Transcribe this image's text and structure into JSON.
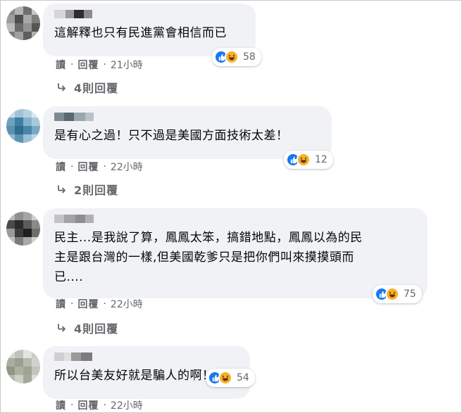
{
  "comments": [
    {
      "text": "這解釋也只有民進黨會相信而已",
      "reaction_count": "58",
      "actions": {
        "read": "讀",
        "reply": "回覆",
        "time": "21小時"
      },
      "replies_label": "4則回覆"
    },
    {
      "text": "是有心之過！只不過是美國方面技術太差！",
      "reaction_count": "12",
      "actions": {
        "read": "讀",
        "reply": "回覆",
        "time": "22小時"
      },
      "replies_label": "2則回覆"
    },
    {
      "text_lines": [
        "民主...是我說了算，鳳鳳太笨，搞錯地點，鳳鳳以為的民",
        "主是跟台灣的一樣,但美國乾爹只是把你們叫來摸摸頭而",
        "已...."
      ],
      "reaction_count": "75",
      "actions": {
        "read": "讀",
        "reply": "回覆",
        "time": "22小時"
      },
      "replies_label": "4則回覆"
    },
    {
      "text": "所以台美友好就是騙人的啊！",
      "reaction_count": "54",
      "actions": {
        "read": "讀",
        "reply": "回覆",
        "time": "22小時"
      }
    }
  ],
  "colors": {
    "bubble": "#f0f2f5",
    "like": "#1877f2",
    "haha": "#f7b125",
    "meta": "#65676b"
  },
  "icons": [
    "like-icon",
    "haha-icon",
    "reply-arrow-icon"
  ]
}
